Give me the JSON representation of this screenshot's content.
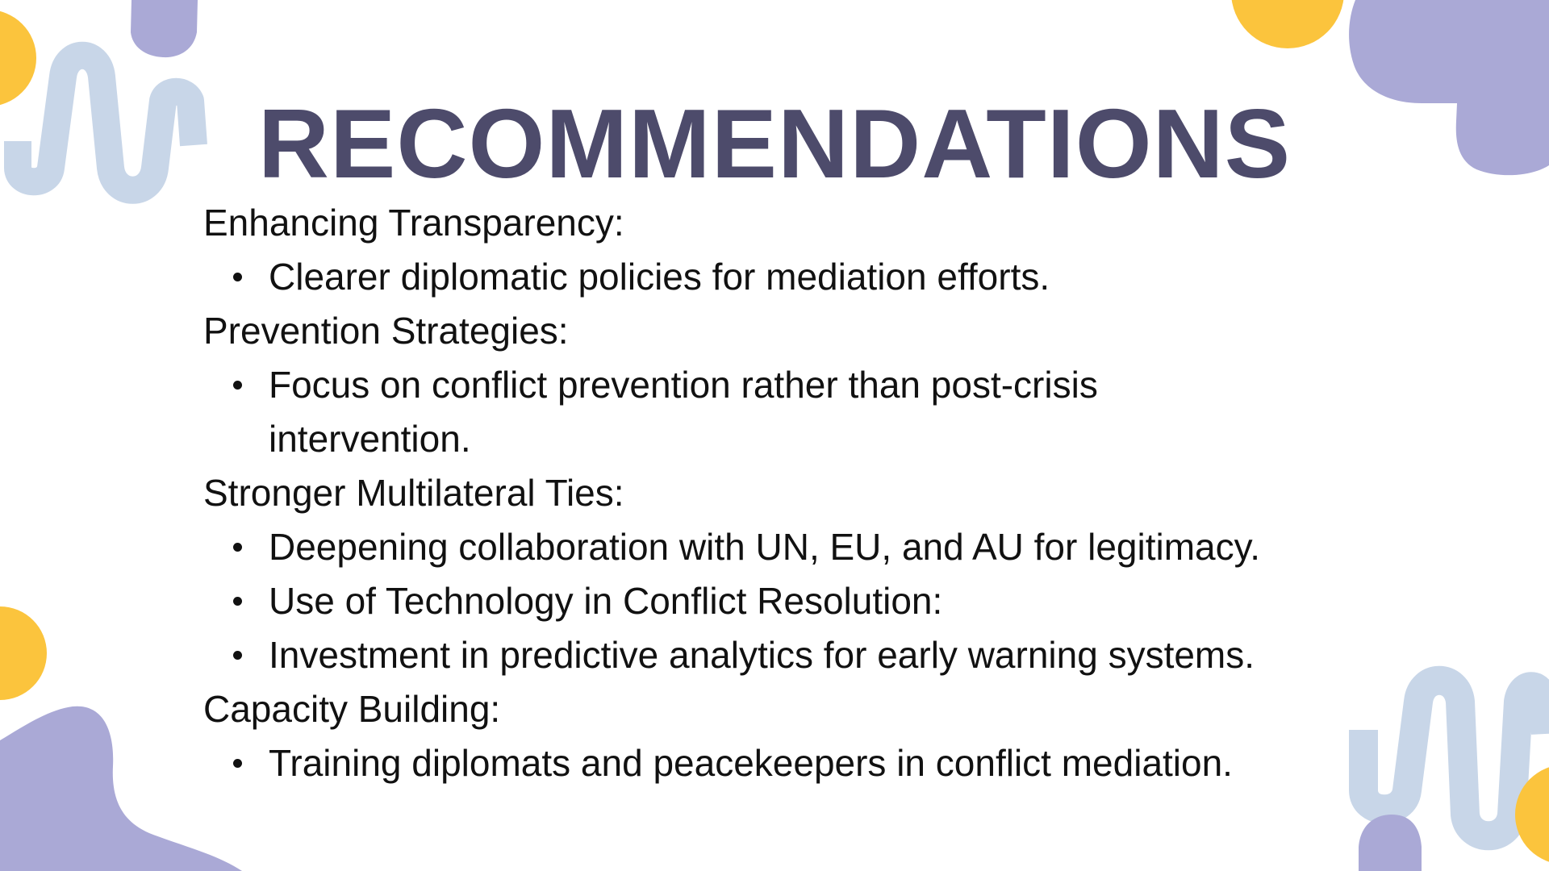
{
  "slide": {
    "title": "RECOMMENDATIONS",
    "colors": {
      "title": "#4d4b6b",
      "text": "#111111",
      "lavender": "#aaa9d6",
      "light_blue": "#c8d6e8",
      "yellow": "#fbc43d"
    },
    "sections": [
      {
        "heading": "Enhancing Transparency:",
        "bullets": [
          "Clearer diplomatic policies for mediation efforts."
        ]
      },
      {
        "heading": "Prevention Strategies:",
        "bullets": [
          "Focus on conflict prevention rather than post-crisis intervention."
        ]
      },
      {
        "heading": "Stronger Multilateral Ties:",
        "bullets": [
          "Deepening collaboration with UN, EU, and AU for legitimacy.",
          "Use of Technology in Conflict Resolution:",
          "Investment in predictive analytics for early warning systems."
        ]
      },
      {
        "heading": "Capacity Building:",
        "bullets": [
          "Training diplomats and peacekeepers in conflict mediation."
        ]
      }
    ]
  }
}
